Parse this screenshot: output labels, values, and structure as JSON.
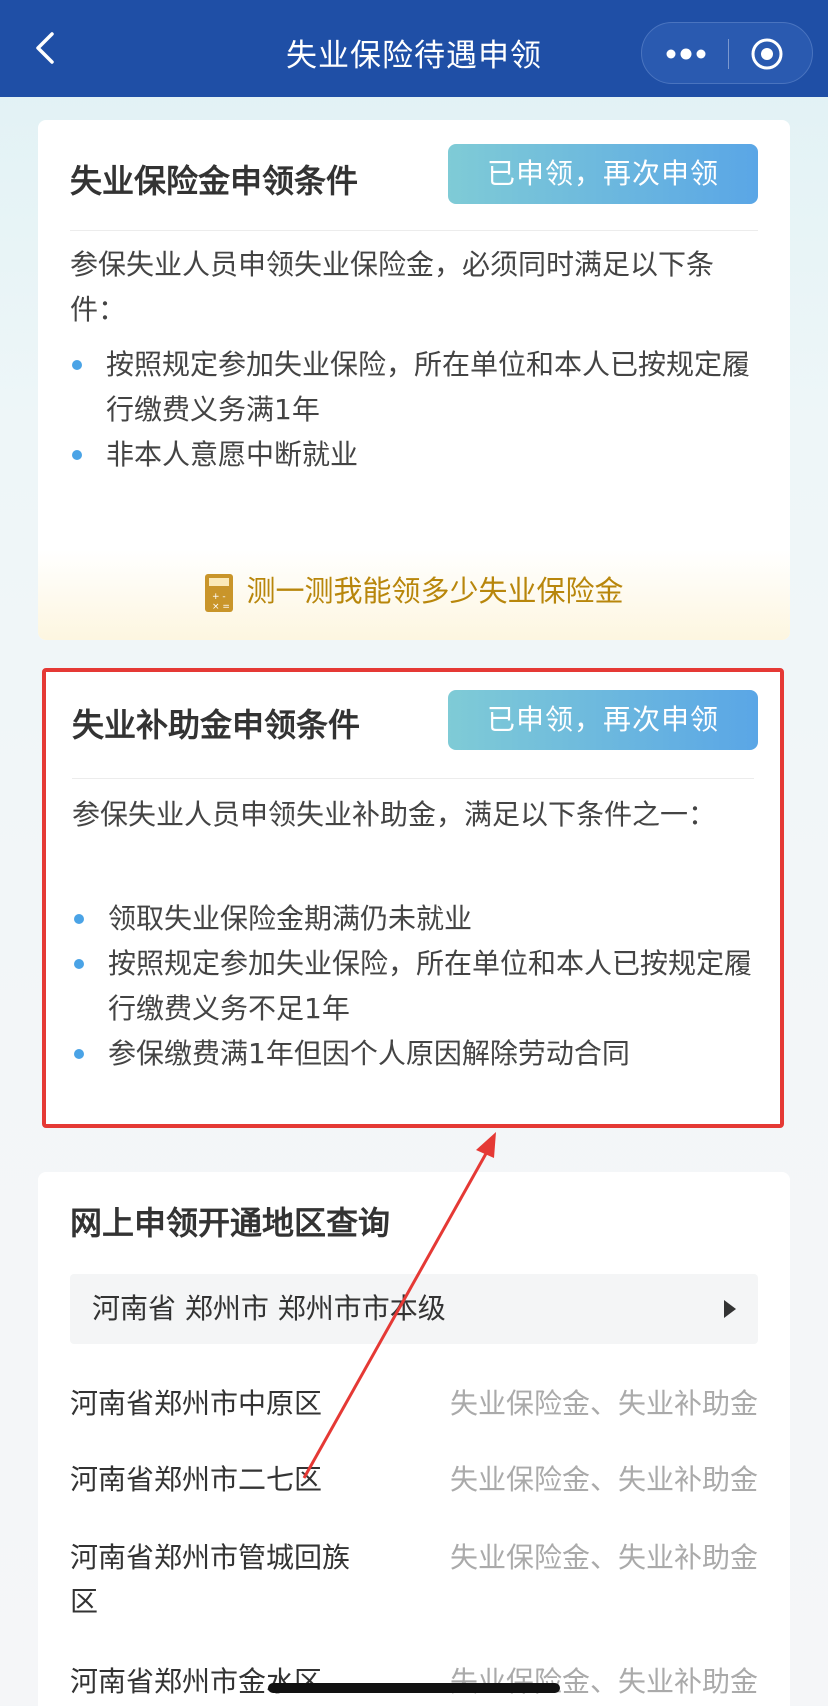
{
  "navbar": {
    "title": "失业保险待遇申领"
  },
  "card_insurance": {
    "title": "失业保险金申领条件",
    "reapply_label": "已申领，再次申领",
    "intro": "参保失业人员申领失业保险金，必须同时满足以下条件：",
    "conditions": [
      "按照规定参加失业保险，所在单位和本人已按规定履行缴费义务满1年",
      "非本人意愿中断就业"
    ],
    "calc_link": "测一测我能领多少失业保险金"
  },
  "card_subsidy": {
    "title": "失业补助金申领条件",
    "reapply_label": "已申领，再次申领",
    "intro": "参保失业人员申领失业补助金，满足以下条件之一：",
    "conditions": [
      "领取失业保险金期满仍未就业",
      "按照规定参加失业保险，所在单位和本人已按规定履行缴费义务不足1年",
      "参保缴费满1年但因个人原因解除劳动合同"
    ]
  },
  "card_regions": {
    "title": "网上申领开通地区查询",
    "selected_region": "河南省 郑州市 郑州市市本级",
    "rows": [
      {
        "name": "河南省郑州市中原区",
        "types": "失业保险金、失业补助金"
      },
      {
        "name": "河南省郑州市二七区",
        "types": "失业保险金、失业补助金"
      },
      {
        "name": "河南省郑州市管城回族区",
        "types": "失业保险金、失业补助金"
      },
      {
        "name": "河南省郑州市金水区",
        "types": "失业保险金、失业补助金"
      }
    ]
  },
  "colors": {
    "nav_bg": "#1f4fa6",
    "highlight_border": "#e53935",
    "bullet": "#4aa3e6",
    "calc_text": "#b8860b"
  }
}
